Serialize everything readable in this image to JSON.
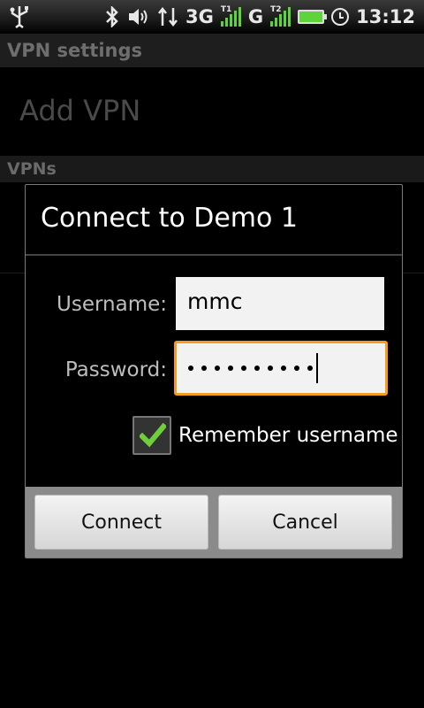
{
  "status_bar": {
    "network_type": "3G",
    "network_g": "G",
    "sim1_label": "T1",
    "sim2_label": "T2",
    "time": "13:12",
    "icons": [
      "usb-icon",
      "bluetooth-icon",
      "volume-icon",
      "data-transfer-icon",
      "signal-icon",
      "battery-charging-icon",
      "alarm-clock-icon"
    ]
  },
  "screen": {
    "title": "VPN settings",
    "add_vpn": "Add VPN",
    "vpns_header": "VPNs"
  },
  "dialog": {
    "title": "Connect to Demo 1",
    "username_label": "Username:",
    "username_value": "mmc",
    "password_label": "Password:",
    "password_length": 10,
    "remember_label": "Remember username",
    "remember_checked": true,
    "connect_label": "Connect",
    "cancel_label": "Cancel"
  },
  "colors": {
    "focus_border": "#f39c1e",
    "check_green": "#6fcf3a",
    "signal_green": "#5fd33a"
  }
}
